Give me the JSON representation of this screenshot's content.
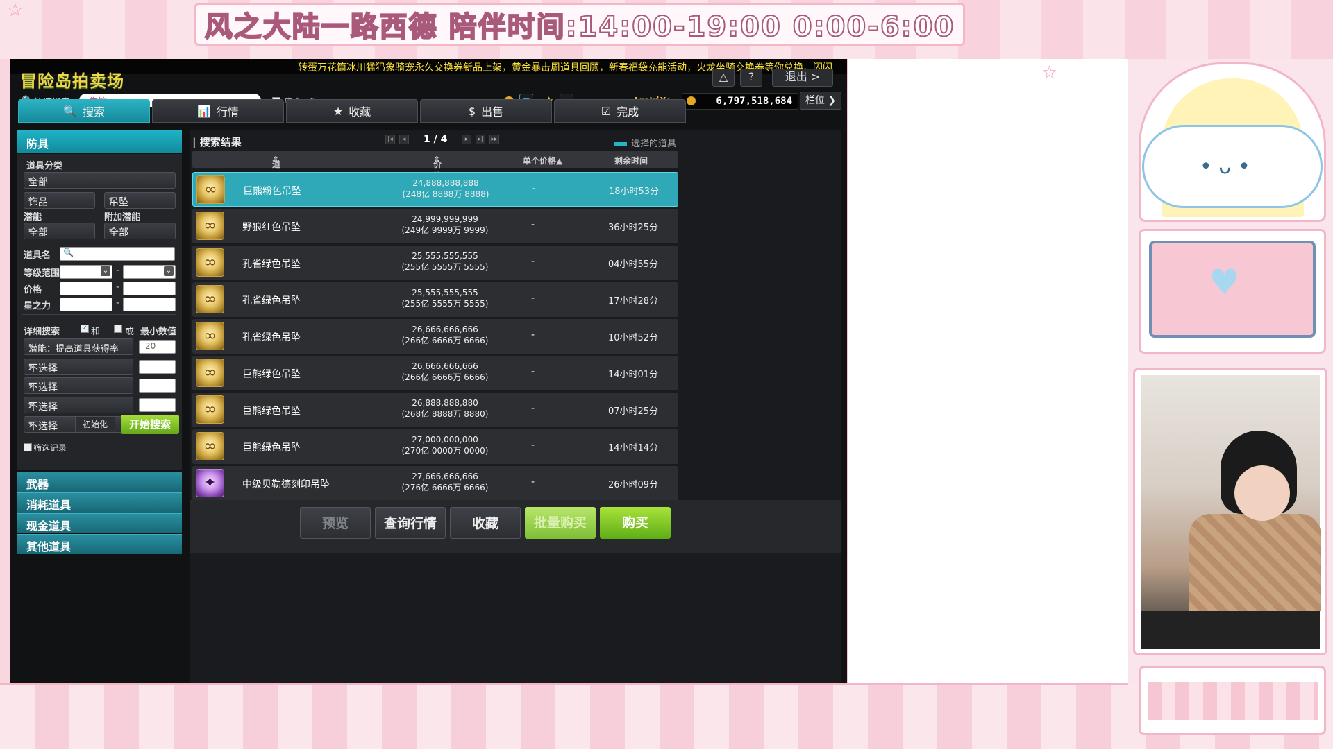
{
  "overlay": {
    "banner": "风之大陆一路西德  陪伴时间:14:00-19:00 0:00-6:00"
  },
  "app": {
    "title": "冒险岛拍卖场",
    "ticker": "转蛋万花筒冰川猛犸象骑宠永久交换券新品上架，黄金暴击周道具回顾，新春福袋充能活动，火龙坐骑交换券等你兑换。闪闪",
    "top_buttons": [
      "△",
      "?",
      "退出 >"
    ],
    "user_name": "ArakiYo",
    "meso": "6,797,518,684",
    "slot_button": "栏位"
  },
  "search": {
    "label": "快速搜索",
    "value": "失控",
    "exact_match": "完全一致"
  },
  "tabs": [
    {
      "icon": "🔍",
      "label": "搜索",
      "active": true
    },
    {
      "icon": "📊",
      "label": "行情",
      "active": false
    },
    {
      "icon": "★",
      "label": "收藏",
      "active": false
    },
    {
      "icon": "$",
      "label": "出售",
      "active": false
    },
    {
      "icon": "☑",
      "label": "完成",
      "active": false
    }
  ],
  "filters": {
    "category": "防具",
    "item_class_label": "道具分类",
    "class_all": "全部",
    "class_sub1": "饰品",
    "class_sub2": "吊坠",
    "potential_label": "潜能",
    "bonus_potential_label": "附加潜能",
    "potential_value": "全部",
    "bonus_potential_value": "全部",
    "item_name_label": "道具名",
    "level_range_label": "等级范围",
    "price_label": "价格",
    "starforce_label": "星之力",
    "detail_label": "详细搜索",
    "and_label": "和",
    "or_label": "或",
    "min_value_label": "最小数值",
    "detail_rows": [
      {
        "option": "潜能：提高道具获得率",
        "value": "20"
      },
      {
        "option": "不选择",
        "value": ""
      },
      {
        "option": "不选择",
        "value": ""
      },
      {
        "option": "不选择",
        "value": ""
      },
      {
        "option": "不选择",
        "value": ""
      }
    ],
    "record_label": "筛选记录",
    "reset_button": "初始化",
    "search_button": "开始搜索"
  },
  "categories": [
    "武器",
    "消耗道具",
    "现金道具",
    "其他道具"
  ],
  "results": {
    "title": "搜索结果",
    "page": "1 / 4",
    "legend": "选择的道具",
    "columns": [
      "道具名称",
      "价格",
      "单个价格▲",
      "剩余时间"
    ],
    "rows": [
      {
        "name": "巨熊粉色吊坠",
        "price": "24,888,888,888",
        "price_detail": "(248亿 8888万 8888)",
        "unit": "-",
        "time": "18小时53分",
        "selected": true,
        "icon": "gold"
      },
      {
        "name": "野狼红色吊坠",
        "price": "24,999,999,999",
        "price_detail": "(249亿 9999万 9999)",
        "unit": "-",
        "time": "36小时25分",
        "selected": false,
        "icon": "gold"
      },
      {
        "name": "孔雀绿色吊坠",
        "price": "25,555,555,555",
        "price_detail": "(255亿 5555万 5555)",
        "unit": "-",
        "time": "04小时55分",
        "selected": false,
        "icon": "gold"
      },
      {
        "name": "孔雀绿色吊坠",
        "price": "25,555,555,555",
        "price_detail": "(255亿 5555万 5555)",
        "unit": "-",
        "time": "17小时28分",
        "selected": false,
        "icon": "gold"
      },
      {
        "name": "孔雀绿色吊坠",
        "price": "26,666,666,666",
        "price_detail": "(266亿 6666万 6666)",
        "unit": "-",
        "time": "10小时52分",
        "selected": false,
        "icon": "gold"
      },
      {
        "name": "巨熊绿色吊坠",
        "price": "26,666,666,666",
        "price_detail": "(266亿 6666万 6666)",
        "unit": "-",
        "time": "14小时01分",
        "selected": false,
        "icon": "gold"
      },
      {
        "name": "巨熊绿色吊坠",
        "price": "26,888,888,880",
        "price_detail": "(268亿 8888万 8880)",
        "unit": "-",
        "time": "07小时25分",
        "selected": false,
        "icon": "gold"
      },
      {
        "name": "巨熊绿色吊坠",
        "price": "27,000,000,000",
        "price_detail": "(270亿 0000万 0000)",
        "unit": "-",
        "time": "14小时14分",
        "selected": false,
        "icon": "gold"
      },
      {
        "name": "中级贝勒德刻印吊坠",
        "price": "27,666,666,666",
        "price_detail": "(276亿 6666万 6666)",
        "unit": "-",
        "time": "26小时09分",
        "selected": false,
        "icon": "purple"
      }
    ]
  },
  "actions": {
    "preview": "预览",
    "market": "查询行情",
    "favorite": "收藏",
    "bulk_buy": "批量购买",
    "buy": "购买"
  }
}
